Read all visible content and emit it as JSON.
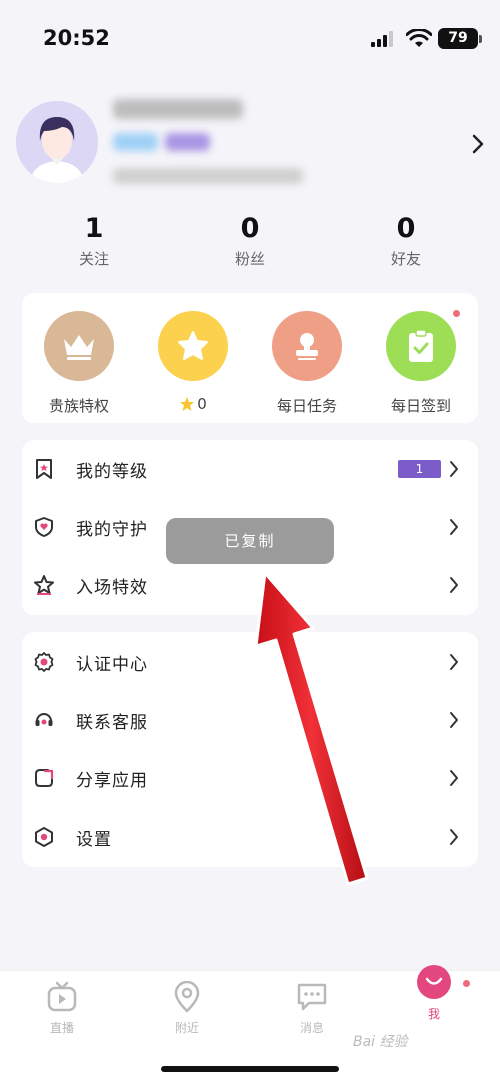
{
  "status": {
    "time": "20:52",
    "battery": "79"
  },
  "stats": [
    {
      "num": "1",
      "label": "关注"
    },
    {
      "num": "0",
      "label": "粉丝"
    },
    {
      "num": "0",
      "label": "好友"
    }
  ],
  "quick": {
    "noble": "贵族特权",
    "star_count": "0",
    "daily_task": "每日任务",
    "checkin": "每日签到"
  },
  "menu1": {
    "level": "我的等级",
    "level_badge": "1",
    "guard": "我的守护",
    "entry": "入场特效"
  },
  "menu2": {
    "verify": "认证中心",
    "support": "联系客服",
    "share": "分享应用",
    "settings": "设置"
  },
  "toast": "已复制",
  "tabs": {
    "live": "直播",
    "nearby": "附近",
    "messages": "消息",
    "me": "我"
  },
  "watermark": "Bai 经验",
  "colors": {
    "accent": "#e2477d",
    "badge": "#7b5cc8",
    "background": "#f5f4f9"
  }
}
